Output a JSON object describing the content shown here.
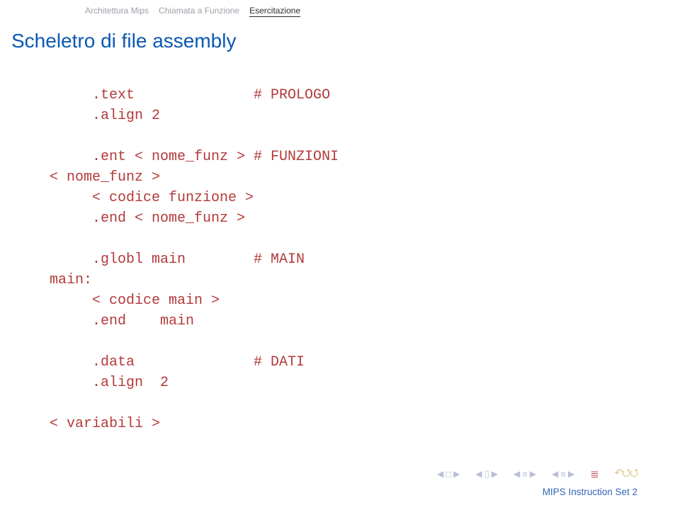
{
  "breadcrumb": {
    "items": [
      {
        "label": "Architettura Mips"
      },
      {
        "label": "Chiamata a Funzione"
      },
      {
        "label": "Esercitazione"
      }
    ],
    "active_index": 2
  },
  "title": "Scheletro di file assembly",
  "code": {
    "l1": "     .text              # PROLOGO",
    "l2": "     .align 2",
    "l3": "",
    "l4": "     .ent < nome_funz > # FUNZIONI",
    "l5": "< nome_funz >",
    "l6": "     < codice funzione >",
    "l7": "     .end < nome_funz >",
    "l8": "",
    "l9": "     .globl main        # MAIN",
    "l10": "main:",
    "l11": "     < codice main >",
    "l12": "     .end    main",
    "l13": "",
    "l14": "     .data              # DATI",
    "l15": "     .align  2",
    "l16": "",
    "l17": "< variabili >"
  },
  "nav_icons": {
    "left": "◀",
    "right": "▶",
    "box": "□",
    "stack": "▯",
    "line_lt": "≡",
    "line_rt": "≡",
    "eq": "≣",
    "undo_a": "↶",
    "undo_q": "⭯"
  },
  "footer_title": "MIPS Instruction Set 2"
}
